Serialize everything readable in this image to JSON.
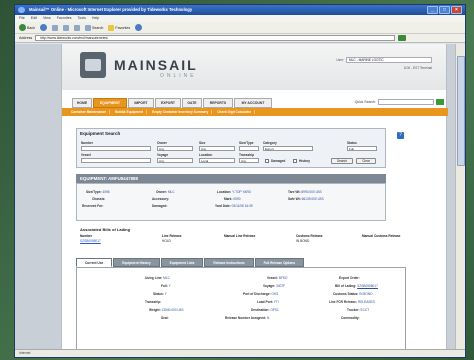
{
  "window": {
    "title": "Mainsail™ Online - Microsoft Internet Explorer provided by Tideworks Technology"
  },
  "menu": [
    "File",
    "Edit",
    "View",
    "Favorites",
    "Tools",
    "Help"
  ],
  "toolbar": {
    "back": "Back",
    "search": "Search",
    "favorites": "Favorites"
  },
  "address": {
    "label": "Address",
    "value": "http://www.tideworks.com/mol/manualentries/"
  },
  "status": {
    "text": "Internet"
  },
  "header": {
    "brand": "MAINSAIL",
    "brand_sub": "ONLINE",
    "user_label": "User:",
    "user_value": "MLC - MARINE LOGTIC",
    "user_info": "8.00 - EST Terminal"
  },
  "nav": {
    "tabs": [
      "HOME",
      "EQUIPMENT",
      "IMPORT",
      "EXPORT",
      "GATE",
      "REPORTS",
      "MY ACCOUNT"
    ],
    "search_label": "Quick Search:"
  },
  "subnav": [
    "Container Maintenance",
    "Bulkbk Equipment",
    "Empty Container Inventory Summary",
    "Check Digit Calculator"
  ],
  "equipment_search": {
    "title": "Equipment Search",
    "fields": {
      "number": "Number",
      "owner": "Owner",
      "size": "Size",
      "type": "Size/Type",
      "category": "Category",
      "status": "Status",
      "vessel": "Vessel",
      "voyage": "Voyage",
      "location": "Location",
      "transship": "Transship"
    },
    "values": {
      "owner": "Any",
      "size": "Any",
      "category": "Export",
      "status": "Full",
      "voyage": "Any",
      "location": "Local",
      "transship": "Any"
    },
    "checkbox_damaged": "Damaged",
    "checkbox_history": "History",
    "search_button": "Search",
    "clear_button": "Clear"
  },
  "equipment": {
    "header": "EQUIPMENT: AMFU8447888",
    "rows": [
      {
        "label": "Size/Type:",
        "value": "4096"
      },
      {
        "label": "Chassis:",
        "value": ""
      },
      {
        "label": "Reserved For:",
        "value": ""
      },
      {
        "label": "Owner:",
        "value": "MLC"
      },
      {
        "label": "Accessory:",
        "value": ""
      },
      {
        "label": "Damaged:",
        "value": ""
      },
      {
        "label": "Location:",
        "value": "Y-TOP YARD"
      },
      {
        "label": "Mark:",
        "value": "0590"
      },
      {
        "label": "Yard Date:",
        "value": "03/11/08 16:39"
      },
      {
        "label": "Tare Wt:",
        "value": "8990.000 LBS"
      },
      {
        "label": "Safe Wt:",
        "value": "66139.000 LBS"
      }
    ]
  },
  "bol": {
    "title": "Associated Bills of Lading",
    "headers": [
      "Number",
      "Line Release",
      "Manual Line Release",
      "Customs Release",
      "Manual Customs Release"
    ],
    "values": [
      "SZSB0908017",
      "HOLD",
      "",
      "IN BOND",
      ""
    ]
  },
  "tabs2": [
    "Current Use",
    "Equipment History",
    "Equipment Lists",
    "Release Instructions",
    "Full Release Options"
  ],
  "detail": {
    "left": [
      {
        "label": "Using Line:",
        "value": "MLC"
      },
      {
        "label": "Full:",
        "value": "Y"
      },
      {
        "label": "Status:",
        "value": "Y"
      },
      {
        "label": "Transship:",
        "value": ""
      },
      {
        "label": "Weight:",
        "value": "13540.000 LBS"
      },
      {
        "label": "Seal:",
        "value": ""
      }
    ],
    "mid": [
      {
        "label": "Vessel:",
        "value": "BFED"
      },
      {
        "label": "Voyage:",
        "value": "3407F"
      },
      {
        "label": "Port of Discharge:",
        "value": "OKS"
      },
      {
        "label": "Load Port:",
        "value": "YTI"
      },
      {
        "label": "Destination:",
        "value": "OPS1"
      },
      {
        "label": "Release Number Assigned:",
        "value": "N"
      }
    ],
    "right": [
      {
        "label": "Export Order:",
        "value": ""
      },
      {
        "label": "Bill of Lading:",
        "value": "SZSB0908017"
      },
      {
        "label": "Customs Status:",
        "value": "IN BOND"
      },
      {
        "label": "Line FCR Release:",
        "value": "RELEASED"
      },
      {
        "label": "Trucker:",
        "value": "ECCT"
      },
      {
        "label": "Commodity:",
        "value": ""
      }
    ],
    "bottom": [
      {
        "label": "Port LFD:",
        "value": ""
      },
      {
        "label": "Hazardous:",
        "value": ""
      },
      {
        "label": "Required Accessory:",
        "value": ""
      }
    ]
  }
}
